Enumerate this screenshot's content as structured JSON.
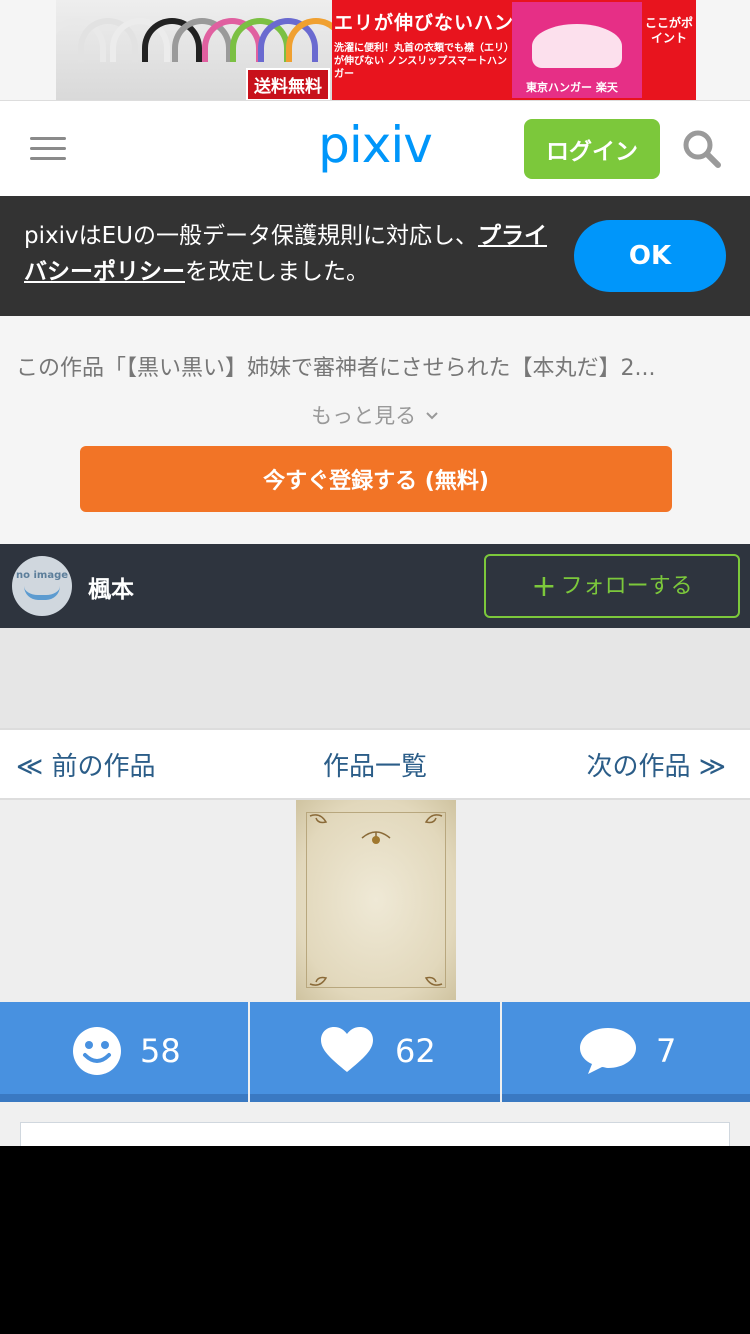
{
  "ad": {
    "title": "エリが伸びないハンガー",
    "subtitle": "洗濯に便利！丸首の衣類でも襟（エリ）が伸びない ノンスリップスマートハンガー",
    "shipping": "送料無料",
    "shop": "東京ハンガー 楽天",
    "point": "ここがポイント"
  },
  "header": {
    "logo": "pixiv",
    "login_label": "ログイン",
    "menu_icon": "hamburger-menu-icon",
    "search_icon": "search-icon"
  },
  "gdpr": {
    "text_before": "pixivはEUの一般データ保護規則に対応し、",
    "link": "プライバシーポリシー",
    "text_after": "を改定しました。",
    "ok_label": "OK"
  },
  "notice": {
    "text": "この作品「【黒い黒い】姉妹で審神者にさせられた【本丸だ】2...",
    "more_label": "もっと見る",
    "register_label": "今すぐ登録する (無料)"
  },
  "user": {
    "name": "楓本",
    "avatar_text": "no image",
    "follow_label": "フォローする",
    "follow_plus": "+"
  },
  "nav": {
    "prev": "≪ 前の作品",
    "list": "作品一覧",
    "next": "次の作品 ≫"
  },
  "stats": {
    "good": "58",
    "likes": "62",
    "comments": "7"
  },
  "colors": {
    "pixiv_blue": "#0096fa",
    "login_green": "#7cc83b",
    "register_orange": "#f27426",
    "stat_blue": "#4891e0",
    "dark_bar": "#2e343e"
  }
}
